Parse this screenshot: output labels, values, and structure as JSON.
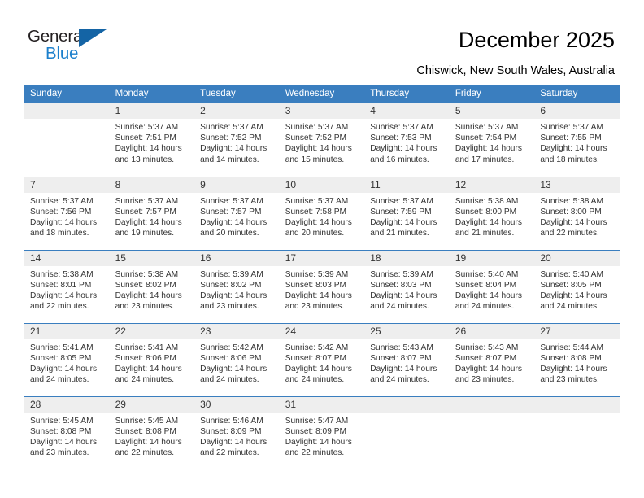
{
  "brand": {
    "name_top": "General",
    "name_bottom": "Blue",
    "accent_color": "#1464a5",
    "blue_text_color": "#1b7fcc"
  },
  "header": {
    "title": "December 2025",
    "subtitle": "Chiswick, New South Wales, Australia"
  },
  "calendar": {
    "header_bg": "#3a7ebf",
    "daynum_bg": "#eeeeee",
    "weekday_headers": [
      "Sunday",
      "Monday",
      "Tuesday",
      "Wednesday",
      "Thursday",
      "Friday",
      "Saturday"
    ],
    "weeks": [
      [
        {
          "day": "",
          "sunrise": "",
          "sunset": "",
          "daylight": "",
          "empty": true
        },
        {
          "day": "1",
          "sunrise": "Sunrise: 5:37 AM",
          "sunset": "Sunset: 7:51 PM",
          "daylight": "Daylight: 14 hours and 13 minutes."
        },
        {
          "day": "2",
          "sunrise": "Sunrise: 5:37 AM",
          "sunset": "Sunset: 7:52 PM",
          "daylight": "Daylight: 14 hours and 14 minutes."
        },
        {
          "day": "3",
          "sunrise": "Sunrise: 5:37 AM",
          "sunset": "Sunset: 7:52 PM",
          "daylight": "Daylight: 14 hours and 15 minutes."
        },
        {
          "day": "4",
          "sunrise": "Sunrise: 5:37 AM",
          "sunset": "Sunset: 7:53 PM",
          "daylight": "Daylight: 14 hours and 16 minutes."
        },
        {
          "day": "5",
          "sunrise": "Sunrise: 5:37 AM",
          "sunset": "Sunset: 7:54 PM",
          "daylight": "Daylight: 14 hours and 17 minutes."
        },
        {
          "day": "6",
          "sunrise": "Sunrise: 5:37 AM",
          "sunset": "Sunset: 7:55 PM",
          "daylight": "Daylight: 14 hours and 18 minutes."
        }
      ],
      [
        {
          "day": "7",
          "sunrise": "Sunrise: 5:37 AM",
          "sunset": "Sunset: 7:56 PM",
          "daylight": "Daylight: 14 hours and 18 minutes."
        },
        {
          "day": "8",
          "sunrise": "Sunrise: 5:37 AM",
          "sunset": "Sunset: 7:57 PM",
          "daylight": "Daylight: 14 hours and 19 minutes."
        },
        {
          "day": "9",
          "sunrise": "Sunrise: 5:37 AM",
          "sunset": "Sunset: 7:57 PM",
          "daylight": "Daylight: 14 hours and 20 minutes."
        },
        {
          "day": "10",
          "sunrise": "Sunrise: 5:37 AM",
          "sunset": "Sunset: 7:58 PM",
          "daylight": "Daylight: 14 hours and 20 minutes."
        },
        {
          "day": "11",
          "sunrise": "Sunrise: 5:37 AM",
          "sunset": "Sunset: 7:59 PM",
          "daylight": "Daylight: 14 hours and 21 minutes."
        },
        {
          "day": "12",
          "sunrise": "Sunrise: 5:38 AM",
          "sunset": "Sunset: 8:00 PM",
          "daylight": "Daylight: 14 hours and 21 minutes."
        },
        {
          "day": "13",
          "sunrise": "Sunrise: 5:38 AM",
          "sunset": "Sunset: 8:00 PM",
          "daylight": "Daylight: 14 hours and 22 minutes."
        }
      ],
      [
        {
          "day": "14",
          "sunrise": "Sunrise: 5:38 AM",
          "sunset": "Sunset: 8:01 PM",
          "daylight": "Daylight: 14 hours and 22 minutes."
        },
        {
          "day": "15",
          "sunrise": "Sunrise: 5:38 AM",
          "sunset": "Sunset: 8:02 PM",
          "daylight": "Daylight: 14 hours and 23 minutes."
        },
        {
          "day": "16",
          "sunrise": "Sunrise: 5:39 AM",
          "sunset": "Sunset: 8:02 PM",
          "daylight": "Daylight: 14 hours and 23 minutes."
        },
        {
          "day": "17",
          "sunrise": "Sunrise: 5:39 AM",
          "sunset": "Sunset: 8:03 PM",
          "daylight": "Daylight: 14 hours and 23 minutes."
        },
        {
          "day": "18",
          "sunrise": "Sunrise: 5:39 AM",
          "sunset": "Sunset: 8:03 PM",
          "daylight": "Daylight: 14 hours and 24 minutes."
        },
        {
          "day": "19",
          "sunrise": "Sunrise: 5:40 AM",
          "sunset": "Sunset: 8:04 PM",
          "daylight": "Daylight: 14 hours and 24 minutes."
        },
        {
          "day": "20",
          "sunrise": "Sunrise: 5:40 AM",
          "sunset": "Sunset: 8:05 PM",
          "daylight": "Daylight: 14 hours and 24 minutes."
        }
      ],
      [
        {
          "day": "21",
          "sunrise": "Sunrise: 5:41 AM",
          "sunset": "Sunset: 8:05 PM",
          "daylight": "Daylight: 14 hours and 24 minutes."
        },
        {
          "day": "22",
          "sunrise": "Sunrise: 5:41 AM",
          "sunset": "Sunset: 8:06 PM",
          "daylight": "Daylight: 14 hours and 24 minutes."
        },
        {
          "day": "23",
          "sunrise": "Sunrise: 5:42 AM",
          "sunset": "Sunset: 8:06 PM",
          "daylight": "Daylight: 14 hours and 24 minutes."
        },
        {
          "day": "24",
          "sunrise": "Sunrise: 5:42 AM",
          "sunset": "Sunset: 8:07 PM",
          "daylight": "Daylight: 14 hours and 24 minutes."
        },
        {
          "day": "25",
          "sunrise": "Sunrise: 5:43 AM",
          "sunset": "Sunset: 8:07 PM",
          "daylight": "Daylight: 14 hours and 24 minutes."
        },
        {
          "day": "26",
          "sunrise": "Sunrise: 5:43 AM",
          "sunset": "Sunset: 8:07 PM",
          "daylight": "Daylight: 14 hours and 23 minutes."
        },
        {
          "day": "27",
          "sunrise": "Sunrise: 5:44 AM",
          "sunset": "Sunset: 8:08 PM",
          "daylight": "Daylight: 14 hours and 23 minutes."
        }
      ],
      [
        {
          "day": "28",
          "sunrise": "Sunrise: 5:45 AM",
          "sunset": "Sunset: 8:08 PM",
          "daylight": "Daylight: 14 hours and 23 minutes."
        },
        {
          "day": "29",
          "sunrise": "Sunrise: 5:45 AM",
          "sunset": "Sunset: 8:08 PM",
          "daylight": "Daylight: 14 hours and 22 minutes."
        },
        {
          "day": "30",
          "sunrise": "Sunrise: 5:46 AM",
          "sunset": "Sunset: 8:09 PM",
          "daylight": "Daylight: 14 hours and 22 minutes."
        },
        {
          "day": "31",
          "sunrise": "Sunrise: 5:47 AM",
          "sunset": "Sunset: 8:09 PM",
          "daylight": "Daylight: 14 hours and 22 minutes."
        },
        {
          "day": "",
          "sunrise": "",
          "sunset": "",
          "daylight": "",
          "empty": true
        },
        {
          "day": "",
          "sunrise": "",
          "sunset": "",
          "daylight": "",
          "empty": true
        },
        {
          "day": "",
          "sunrise": "",
          "sunset": "",
          "daylight": "",
          "empty": true
        }
      ]
    ]
  }
}
